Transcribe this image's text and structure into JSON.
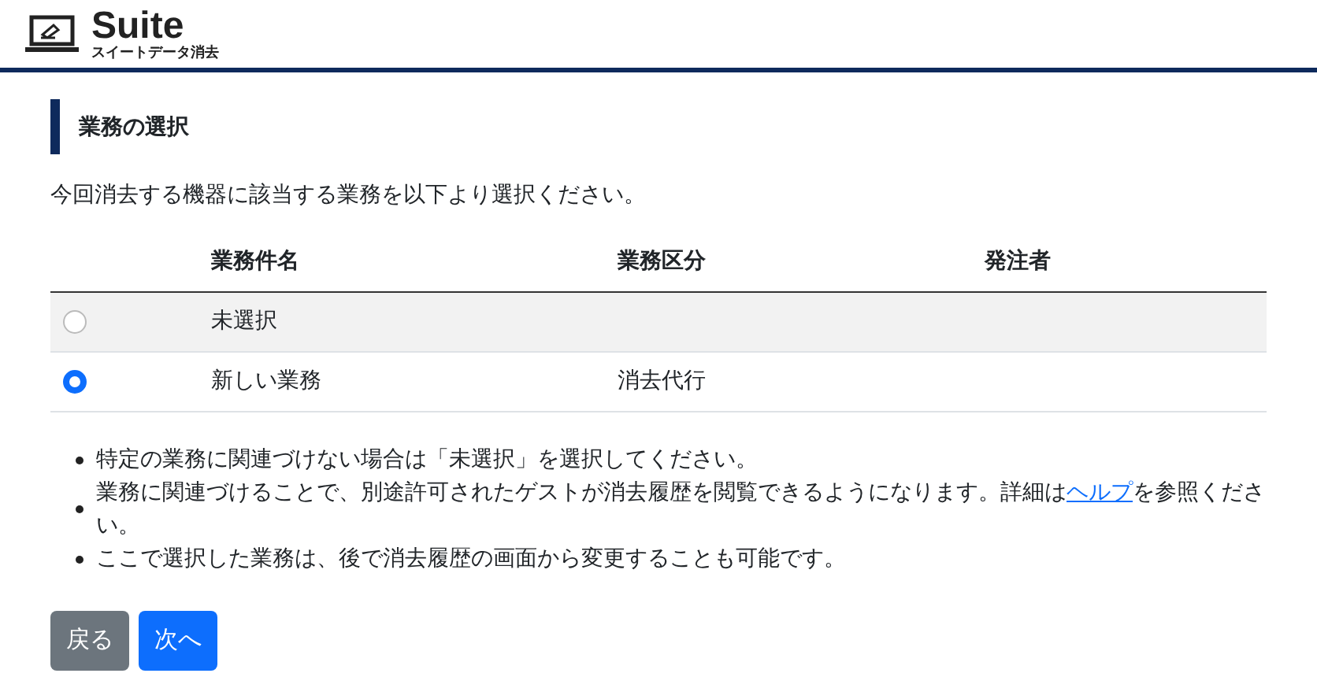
{
  "logo": {
    "title": "Suite",
    "subtitle": "スイートデータ消去"
  },
  "section": {
    "title": "業務の選択"
  },
  "description": "今回消去する機器に該当する業務を以下より選択ください。",
  "table": {
    "columns": [
      "業務件名",
      "業務区分",
      "発注者"
    ],
    "rows": [
      {
        "name": "未選択",
        "category": "",
        "orderer": "",
        "selected": false,
        "highlighted": true
      },
      {
        "name": "新しい業務",
        "category": "消去代行",
        "orderer": "",
        "selected": true,
        "highlighted": false
      }
    ]
  },
  "notes": [
    {
      "text": "特定の業務に関連づけない場合は「未選択」を選択してください。"
    },
    {
      "text": "業務に関連づけることで、別途許可されたゲストが消去履歴を閲覧できるようになります。詳細は",
      "link": "ヘルプ",
      "after": "を参照ください。"
    },
    {
      "text": "ここで選択した業務は、後で消去履歴の画面から変更することも可能です。"
    }
  ],
  "buttons": [
    {
      "label": "戻る",
      "kind": "secondary"
    },
    {
      "label": "次へ",
      "kind": "primary"
    }
  ]
}
